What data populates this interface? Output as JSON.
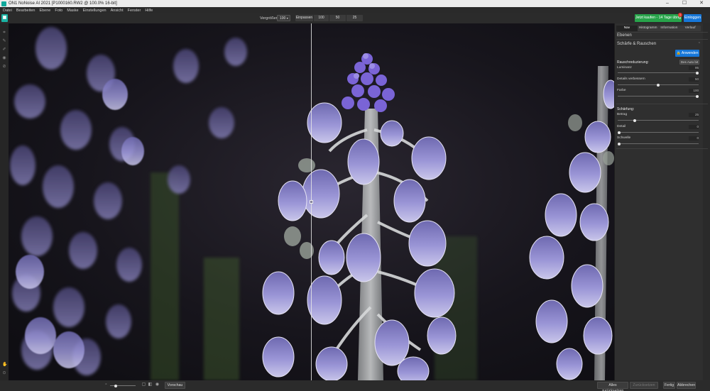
{
  "window": {
    "title": "ON1 NoNoise AI 2021 [P1000160.RW2 @ 100.0% 16-bit]",
    "controls": [
      "minimize-icon",
      "maximize-icon",
      "close-icon"
    ]
  },
  "menu": [
    "Datei",
    "Bearbeiten",
    "Ebene",
    "Foto",
    "Maske",
    "Einstellungen",
    "Ansicht",
    "Fenster",
    "Hilfe"
  ],
  "toolbar": {
    "zoom_label": "Vergrößern",
    "zoom_value": "100",
    "fit_options": [
      "Einpassen",
      "100",
      "50",
      "25"
    ],
    "buy_label": "Jetzt kaufen - 14 Tage übrig",
    "buy_badge": "1",
    "activate_label": "Einloggen"
  },
  "panel": {
    "tabs": [
      {
        "label": "Nav",
        "active": true
      },
      {
        "label": "Histogramm",
        "active": false
      },
      {
        "label": "Information",
        "active": false
      },
      {
        "label": "Verlauf",
        "active": false
      }
    ],
    "layers_title": "Ebenen",
    "section_title": "Schärfe & Rauschen",
    "apply_label": "Anwenden",
    "noise_heading": "Rauschreduzierung:",
    "auto_label": "Des Auto bit",
    "noise_sliders": [
      {
        "label": "Luminanz",
        "value": "95",
        "fraction": 1.0
      },
      {
        "label": "Details verbessern",
        "value": "50",
        "fraction": 0.5
      },
      {
        "label": "Farbe",
        "value": "100",
        "fraction": 1.0
      }
    ],
    "sharpen_heading": "Schärfung:",
    "sharpen_sliders": [
      {
        "label": "Betrag",
        "value": "25",
        "fraction": 0.2
      },
      {
        "label": "Detail",
        "value": "0",
        "fraction": 0.0
      },
      {
        "label": "Schwelle",
        "value": "0",
        "fraction": 0.0
      }
    ]
  },
  "bottom": {
    "preview_label": "Vorschau",
    "reset_all_label": "Alles zurücksetzen",
    "disabled_label": "Zurücksetzen",
    "done_label": "Fertig",
    "cancel_label": "Abbrechen"
  },
  "colors": {
    "accent_blue": "#1677d9",
    "buy_green": "#27a34a",
    "flower_purple": "#8c86c9",
    "background": "#15131a"
  }
}
